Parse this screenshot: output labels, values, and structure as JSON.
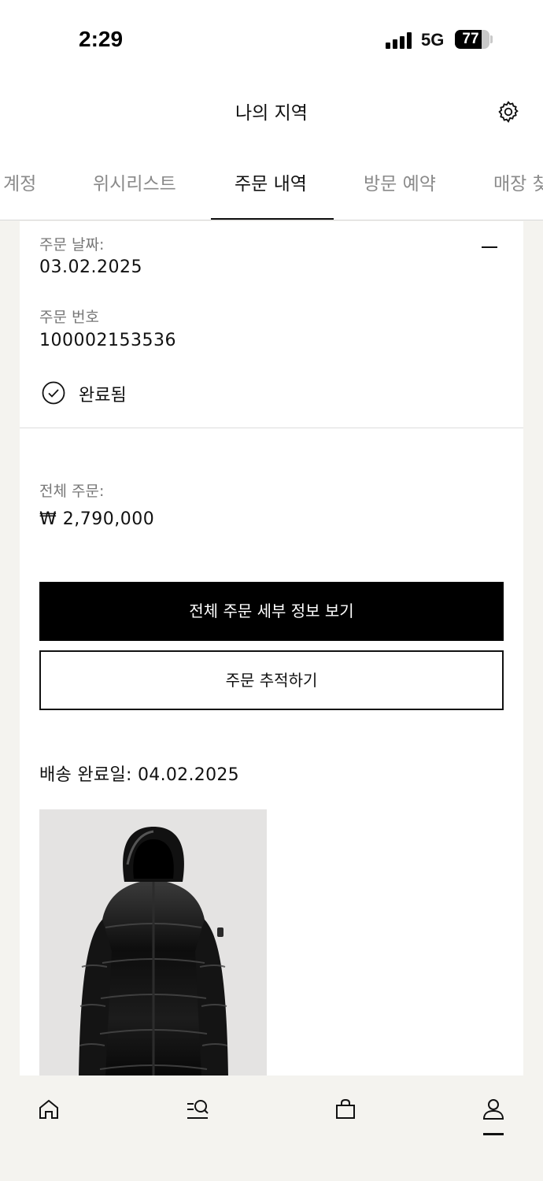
{
  "status_bar": {
    "time": "2:29",
    "network": "5G",
    "battery": "77",
    "battery_level": 0.77
  },
  "header": {
    "title": "나의 지역",
    "settings_icon": "gear-icon"
  },
  "tabs": [
    {
      "label": "계정",
      "active": false
    },
    {
      "label": "위시리스트",
      "active": false
    },
    {
      "label": "주문 내역",
      "active": true
    },
    {
      "label": "방문 예약",
      "active": false
    },
    {
      "label": "매장 찾",
      "active": false
    }
  ],
  "order": {
    "date_label": "주문 날짜:",
    "date_value": "03.02.2025",
    "number_label": "주문 번호",
    "number_value": "100002153536",
    "status": "완료됨",
    "status_icon": "check-circle-icon",
    "total_label": "전체 주문:",
    "total_value": "₩ 2,790,000",
    "details_button": "전체 주문 세부 정보 보기",
    "track_button": "주문 추적하기",
    "delivery_text": "배송 완료일: 04.02.2025"
  },
  "bottom_nav": [
    {
      "icon": "home-icon",
      "active": false
    },
    {
      "icon": "menu-search-icon",
      "active": false
    },
    {
      "icon": "shopping-bag-icon",
      "active": false
    },
    {
      "icon": "user-icon",
      "active": true
    }
  ]
}
